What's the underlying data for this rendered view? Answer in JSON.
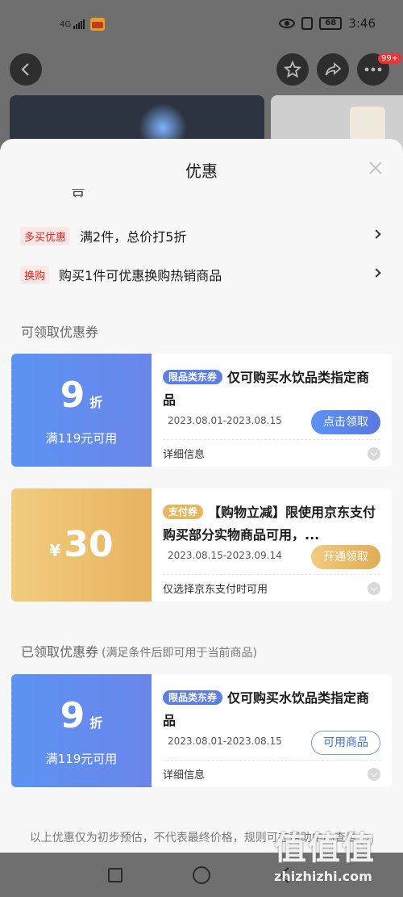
{
  "status_bar": {
    "network": "4G",
    "battery": "68",
    "time": "3:46"
  },
  "header": {
    "more_badge": "99+"
  },
  "sheet": {
    "title": "优惠",
    "cut_text": "豆",
    "promos": [
      {
        "tag": "多买优惠",
        "text": "满2件，总价打5折"
      },
      {
        "tag": "换购",
        "text": "购买1件可优惠换购热销商品"
      }
    ],
    "available_title": "可领取优惠券",
    "claimed_title": "已领取优惠券",
    "claimed_subtitle": "(满足条件后即可用于当前商品)",
    "coupons_available": [
      {
        "amount": "9",
        "unit": "折",
        "condition": "满119元可用",
        "tag": "限品类东券",
        "desc": "仅可购买水饮品类指定商品",
        "dates": "2023.08.01-2023.08.15",
        "button": "点击领取",
        "footer": "详细信息"
      },
      {
        "currency": "¥",
        "amount": "30",
        "tag": "支付券",
        "desc": "【购物立减】限使用京东支付购买部分实物商品可用，...",
        "dates": "2023.08.15-2023.09.14",
        "button": "开通领取",
        "footer": "仅选择京东支付时可用"
      }
    ],
    "coupons_claimed": [
      {
        "amount": "9",
        "unit": "折",
        "condition": "满119元可用",
        "tag": "限品类东券",
        "desc": "仅可购买水饮品类指定商品",
        "dates": "2023.08.01-2023.08.15",
        "button": "可用商品",
        "footer": "详细信息"
      }
    ],
    "disclaimer": "以上优惠仅为初步预估，不代表最终价格，规则可在帮助中心查看",
    "info_icon_label": "?"
  },
  "watermark": {
    "logo": "值值值",
    "url": "zhizhizhi.com"
  }
}
